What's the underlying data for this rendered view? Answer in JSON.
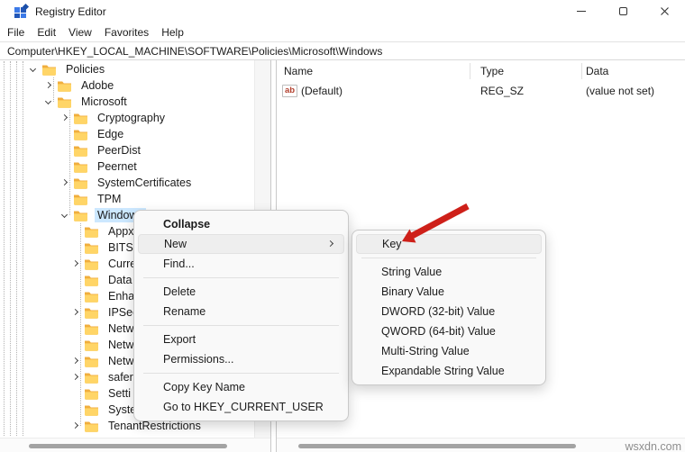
{
  "window": {
    "title": "Registry Editor"
  },
  "menu_bar": {
    "items": [
      {
        "label": "File"
      },
      {
        "label": "Edit"
      },
      {
        "label": "View"
      },
      {
        "label": "Favorites"
      },
      {
        "label": "Help"
      }
    ]
  },
  "address_bar": {
    "value": "Computer\\HKEY_LOCAL_MACHINE\\SOFTWARE\\Policies\\Microsoft\\Windows"
  },
  "tree": {
    "items": [
      {
        "label": "Policies",
        "level": 0,
        "chevron": "expanded",
        "selected": false
      },
      {
        "label": "Adobe",
        "level": 1,
        "chevron": "collapsed",
        "selected": false
      },
      {
        "label": "Microsoft",
        "level": 1,
        "chevron": "expanded",
        "selected": false
      },
      {
        "label": "Cryptography",
        "level": 2,
        "chevron": "collapsed",
        "selected": false
      },
      {
        "label": "Edge",
        "level": 2,
        "chevron": "none",
        "selected": false
      },
      {
        "label": "PeerDist",
        "level": 2,
        "chevron": "none",
        "selected": false
      },
      {
        "label": "Peernet",
        "level": 2,
        "chevron": "none",
        "selected": false
      },
      {
        "label": "SystemCertificates",
        "level": 2,
        "chevron": "collapsed",
        "selected": false
      },
      {
        "label": "TPM",
        "level": 2,
        "chevron": "none",
        "selected": false
      },
      {
        "label": "Windows",
        "level": 2,
        "chevron": "expanded",
        "selected": true
      },
      {
        "label": "Appx",
        "level": 3,
        "chevron": "none",
        "selected": false
      },
      {
        "label": "BITS",
        "level": 3,
        "chevron": "none",
        "selected": false
      },
      {
        "label": "Curre",
        "level": 3,
        "chevron": "collapsed",
        "selected": false
      },
      {
        "label": "Data",
        "level": 3,
        "chevron": "none",
        "selected": false
      },
      {
        "label": "Enha",
        "level": 3,
        "chevron": "none",
        "selected": false
      },
      {
        "label": "IPSec",
        "level": 3,
        "chevron": "collapsed",
        "selected": false
      },
      {
        "label": "Netw",
        "level": 3,
        "chevron": "none",
        "selected": false
      },
      {
        "label": "Netw",
        "level": 3,
        "chevron": "none",
        "selected": false
      },
      {
        "label": "Netw",
        "level": 3,
        "chevron": "collapsed",
        "selected": false
      },
      {
        "label": "safer",
        "level": 3,
        "chevron": "collapsed",
        "selected": false
      },
      {
        "label": "Setti",
        "level": 3,
        "chevron": "none",
        "selected": false
      },
      {
        "label": "Syste",
        "level": 3,
        "chevron": "none",
        "selected": false
      },
      {
        "label": "TenantRestrictions",
        "level": 3,
        "chevron": "collapsed",
        "selected": false
      },
      {
        "label": "",
        "level": 3,
        "chevron": "none",
        "selected": false
      }
    ]
  },
  "value_list": {
    "columns": [
      {
        "label": "Name"
      },
      {
        "label": "Type"
      },
      {
        "label": "Data"
      }
    ],
    "rows": [
      {
        "icon_text": "ab",
        "name": "(Default)",
        "type": "REG_SZ",
        "data": "(value not set)"
      }
    ]
  },
  "context_menu": {
    "items": [
      {
        "label": "Collapse"
      },
      {
        "label": "New"
      },
      {
        "label": "Find..."
      },
      {
        "label": "Delete"
      },
      {
        "label": "Rename"
      },
      {
        "label": "Export"
      },
      {
        "label": "Permissions..."
      },
      {
        "label": "Copy Key Name"
      },
      {
        "label": "Go to HKEY_CURRENT_USER"
      }
    ]
  },
  "submenu": {
    "items": [
      {
        "label": "Key"
      },
      {
        "label": "String Value"
      },
      {
        "label": "Binary Value"
      },
      {
        "label": "DWORD (32-bit) Value"
      },
      {
        "label": "QWORD (64-bit) Value"
      },
      {
        "label": "Multi-String Value"
      },
      {
        "label": "Expandable String Value"
      }
    ]
  },
  "annotation": {
    "arrow_color": "#ce2019",
    "points_to": "Key"
  },
  "watermark": {
    "text": "wsxdn.com"
  }
}
